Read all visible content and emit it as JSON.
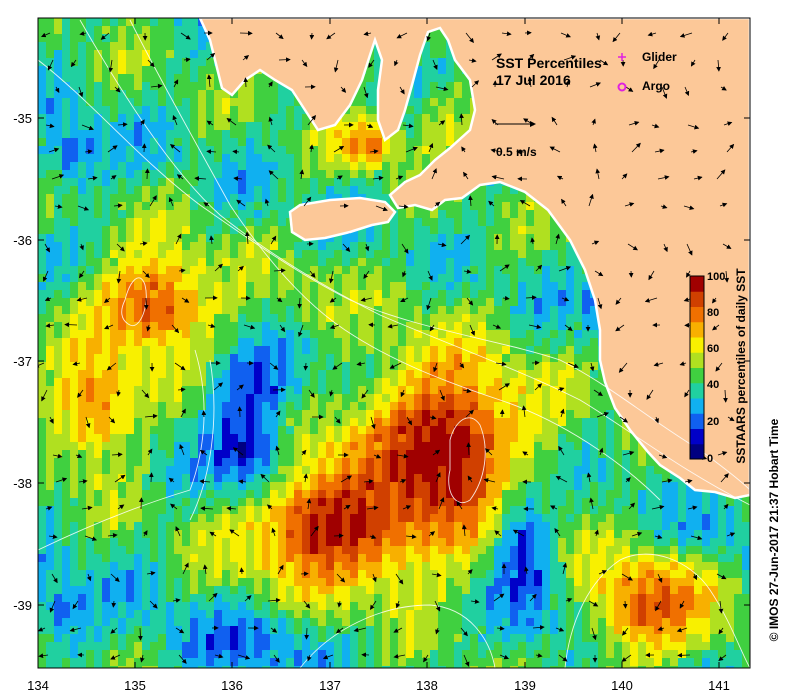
{
  "map": {
    "title_line1": "SST Percentiles",
    "title_line2": "17 Jul 2016",
    "legend": [
      {
        "label": "Glider",
        "color": "#e020e0",
        "icon": "plus-icon"
      },
      {
        "label": "Argo",
        "color": "#e020e0",
        "icon": "ring-icon"
      }
    ],
    "scale_arrow_label": "0.5 m/s",
    "credit": "© IMOS 27-Jun-2017 21:37 Hobart Time",
    "colors": {
      "land": "#fcc898",
      "coast": "#ffffff"
    }
  },
  "axes": {
    "x_ticks": [
      "134",
      "135",
      "136",
      "137",
      "138",
      "139",
      "140",
      "141"
    ],
    "y_ticks": [
      "-35",
      "-36",
      "-37",
      "-38",
      "-39"
    ]
  },
  "colorbar": {
    "label": "SSTAARS percentiles of daily  SST",
    "ticks": [
      "0",
      "20",
      "40",
      "60",
      "80",
      "100"
    ],
    "colors": [
      "#000080",
      "#0000c8",
      "#1060f0",
      "#10b0f0",
      "#20d0a0",
      "#40d040",
      "#b0e020",
      "#f8f000",
      "#f8b000",
      "#f07000",
      "#d04000",
      "#a00000"
    ]
  }
}
